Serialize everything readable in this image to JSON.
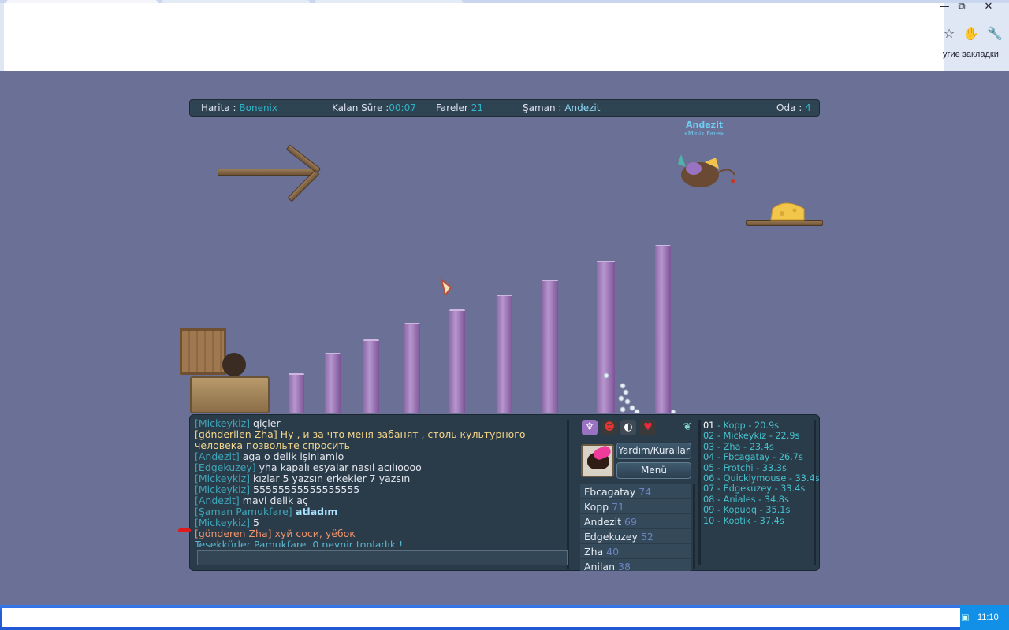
{
  "browser": {
    "bookmarks_label": "угие закладки",
    "controls": [
      "—",
      "⧉",
      "✕"
    ]
  },
  "hud": {
    "map_label": "Harita :",
    "map_value": "Bonenix",
    "time_label": "Kalan Süre :",
    "time_value": "00:07",
    "mice_label": "Fareler",
    "mice_value": "21",
    "shaman_label": "Şaman :",
    "shaman_value": "Andezit",
    "room_label": "Oda :",
    "room_value": "4"
  },
  "scene": {
    "shaman_name": "Andezit",
    "shaman_title": "«Minik Fare»"
  },
  "chat": {
    "lines": [
      {
        "name": "[Mickeykiz]",
        "text": " qiçler"
      },
      {
        "name": "[gönderilen Zha]",
        "text": " Ну , и за что меня забанят , столь культурного"
      },
      {
        "name": "",
        "text": "человека позвольте спросить"
      },
      {
        "name": "[Andezit]",
        "text": " aga o delik işinlamio"
      },
      {
        "name": "[Edgekuzey]",
        "text": " yha kapalı esyalar nasıl acılıoooo"
      },
      {
        "name": "[Mickeykiz]",
        "text": " kızlar 5 yazsın erkekler 7 yazsın"
      },
      {
        "name": "[Mickeykiz]",
        "text": " 55555555555555555"
      },
      {
        "name": "[Andezit]",
        "text": " mavi delik aç"
      },
      {
        "name": "[Şaman Pamukfare]",
        "text": " atladım"
      },
      {
        "name": "[Mickeykiz]",
        "text": " 5"
      },
      {
        "name": "[gönderen Zha]",
        "text": " хуй соси, уёбок"
      },
      {
        "name": "",
        "text": "Teşekkürler Pamukfare, 0 peynir topladık !"
      }
    ]
  },
  "buttons": {
    "help": "Yardım/Kurallar",
    "menu": "Menü"
  },
  "players": [
    {
      "name": "Fbcagatay",
      "score": "74"
    },
    {
      "name": "Kopp",
      "score": "71"
    },
    {
      "name": "Andezit",
      "score": "69"
    },
    {
      "name": "Edgekuzey",
      "score": "52"
    },
    {
      "name": "Zha",
      "score": "40"
    },
    {
      "name": "Anilan",
      "score": "38"
    }
  ],
  "ranking": [
    {
      "pos": "01",
      "text": " - Kopp - 20.9s"
    },
    {
      "pos": "02",
      "text": " - Mickeykiz - 22.9s"
    },
    {
      "pos": "03",
      "text": " - Zha - 23.4s"
    },
    {
      "pos": "04",
      "text": " - Fbcagatay - 26.7s"
    },
    {
      "pos": "05",
      "text": " - Frotchi - 33.3s"
    },
    {
      "pos": "06",
      "text": " - Quicklymouse - 33.4s"
    },
    {
      "pos": "07",
      "text": " - Edgekuzey - 33.4s"
    },
    {
      "pos": "08",
      "text": " - Aniales - 34.8s"
    },
    {
      "pos": "09",
      "text": " - Kopuqq - 35.1s"
    },
    {
      "pos": "10",
      "text": " - Kootik - 37.4s"
    }
  ],
  "taskbar": {
    "clock": "11:10"
  }
}
